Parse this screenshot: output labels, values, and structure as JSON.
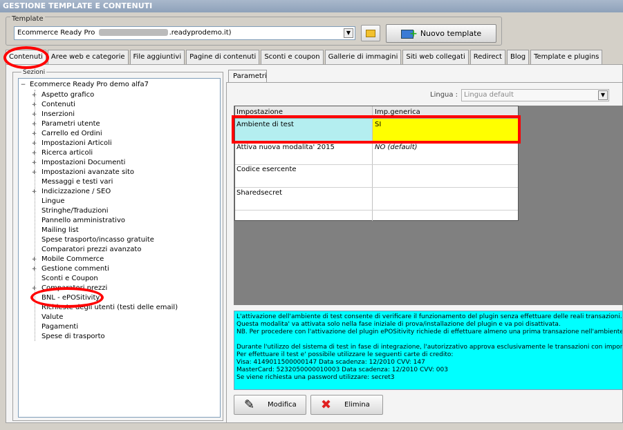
{
  "window": {
    "title": "GESTIONE TEMPLATE E CONTENUTI"
  },
  "template_group": {
    "legend": "Template",
    "selected_prefix": "Ecommerce Ready Pro",
    "selected_suffix": ".readyprodemo.it)",
    "new_template_label": "Nuovo template"
  },
  "tabs": [
    "Contenuti",
    "Aree web e categorie",
    "File aggiuntivi",
    "Pagine di contenuti",
    "Sconti e coupon",
    "Gallerie di immagini",
    "Siti web collegati",
    "Redirect",
    "Blog",
    "Template e plugins"
  ],
  "sections": {
    "legend": "Sezioni",
    "root": "Ecommerce Ready Pro demo alfa7",
    "items": [
      {
        "label": "Aspetto grafico",
        "expandable": true
      },
      {
        "label": "Contenuti",
        "expandable": true
      },
      {
        "label": "Inserzioni",
        "expandable": true
      },
      {
        "label": "Parametri utente",
        "expandable": true
      },
      {
        "label": "Carrello ed Ordini",
        "expandable": true
      },
      {
        "label": "Impostazioni Articoli",
        "expandable": true
      },
      {
        "label": "Ricerca articoli",
        "expandable": true
      },
      {
        "label": "Impostazioni Documenti",
        "expandable": true
      },
      {
        "label": "Impostazioni avanzate sito",
        "expandable": true
      },
      {
        "label": "Messaggi e testi vari",
        "expandable": false
      },
      {
        "label": "Indicizzazione / SEO",
        "expandable": true
      },
      {
        "label": "Lingue",
        "expandable": false
      },
      {
        "label": "Stringhe/Traduzioni",
        "expandable": false
      },
      {
        "label": "Pannello amministrativo",
        "expandable": false
      },
      {
        "label": "Mailing list",
        "expandable": false
      },
      {
        "label": "Spese trasporto/incasso gratuite",
        "expandable": false
      },
      {
        "label": "Comparatori prezzi avanzato",
        "expandable": false
      },
      {
        "label": "Mobile Commerce",
        "expandable": true
      },
      {
        "label": "Gestione commenti",
        "expandable": true
      },
      {
        "label": "Sconti e Coupon",
        "expandable": false
      },
      {
        "label": "Comparatori prezzi",
        "expandable": true
      },
      {
        "label": "BNL - ePOSitivity",
        "expandable": false
      },
      {
        "label": "Richieste degli utenti (testi delle email)",
        "expandable": false
      },
      {
        "label": "Valute",
        "expandable": false
      },
      {
        "label": "Pagamenti",
        "expandable": false
      },
      {
        "label": "Spese di trasporto",
        "expandable": false
      }
    ]
  },
  "params": {
    "tab_label": "Parametri",
    "language_label": "Lingua :",
    "language_value": "Lingua default",
    "columns": [
      "Impostazione",
      "Imp.generica"
    ],
    "rows": [
      {
        "name": "Ambiente di test",
        "value": "SI"
      },
      {
        "name": "Attiva nuova modalita' 2015",
        "value": "NO (default)"
      },
      {
        "name": "Codice esercente",
        "value": ""
      },
      {
        "name": "Sharedsecret",
        "value": ""
      }
    ]
  },
  "info_lines": [
    "L'attivazione dell'ambiente di test consente di verificare il funzionamento del plugin senza effettuare delle reali transazioni.",
    "Questa modalita' va attivata solo nella fase iniziale di prova/installazione del plugin e va poi disattivata.",
    "NB. Per procedere con l'attivazione del plugin ePOSitivity richiede di effettuare almeno una prima transazione nell'ambiente di",
    "",
    "Durante l'utilizzo del sistema di test in fase di integrazione, l'autorizzativo approva esclusivamente le transazioni con importi senza",
    "Per effettuare il test e' possibile utilizzare le seguenti carte di credito:",
    "Visa: 4149011500000147 Data scadenza: 12/2010 CVV: 147",
    "MasterCard: 5232050000010003 Data scadenza: 12/2010 CVV: 003",
    "Se viene richiesta una password utilizzare: secret3"
  ],
  "buttons": {
    "edit": "Modifica",
    "delete": "Elimina"
  },
  "colors": {
    "highlight": "#ff0000",
    "info_bg": "#00ffff",
    "selected_value_bg": "#ffff00",
    "selected_name_bg": "#b4eef0"
  }
}
